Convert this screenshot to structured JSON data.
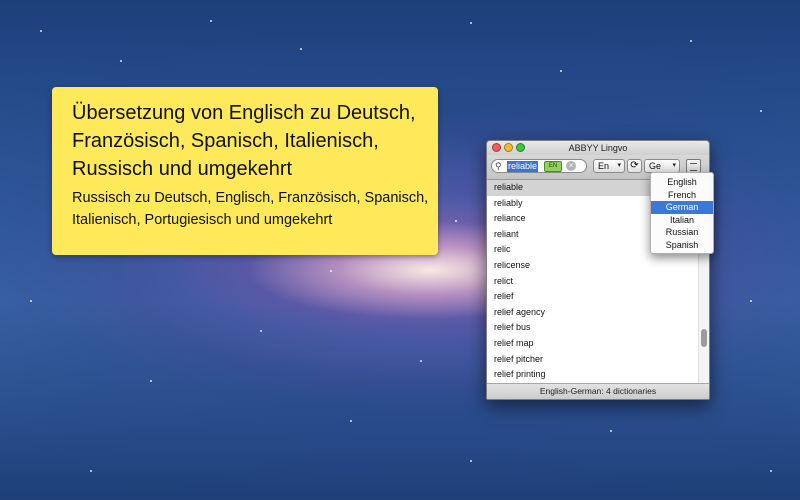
{
  "promo": {
    "title": "Übersetzung von Englisch zu Deutsch, Französisch, Spanisch, Italienisch, Russisch und umgekehrt",
    "subtitle": "Russisch zu Deutsch, Englisch, Französisch, Spanisch, Italienisch, Portugiesisch und umgekehrt"
  },
  "window": {
    "title": "ABBYY Lingvo",
    "search_value": "reliable",
    "keyboard_label": "EN",
    "source_language": "En",
    "target_language": "Ge",
    "entries": [
      "reliable",
      "reliably",
      "reliance",
      "reliant",
      "relic",
      "relicense",
      "relict",
      "relief",
      "relief agency",
      "relief bus",
      "relief map",
      "relief pitcher",
      "relief printing"
    ],
    "selected_entry_index": 0,
    "status": "English-German: 4 dictionaries"
  },
  "language_menu": {
    "items": [
      "English",
      "French",
      "German",
      "Italian",
      "Russian",
      "Spanish"
    ],
    "active": "German"
  },
  "colors": {
    "promo_background": "#fde95a",
    "selection_blue": "#3b78d8"
  }
}
